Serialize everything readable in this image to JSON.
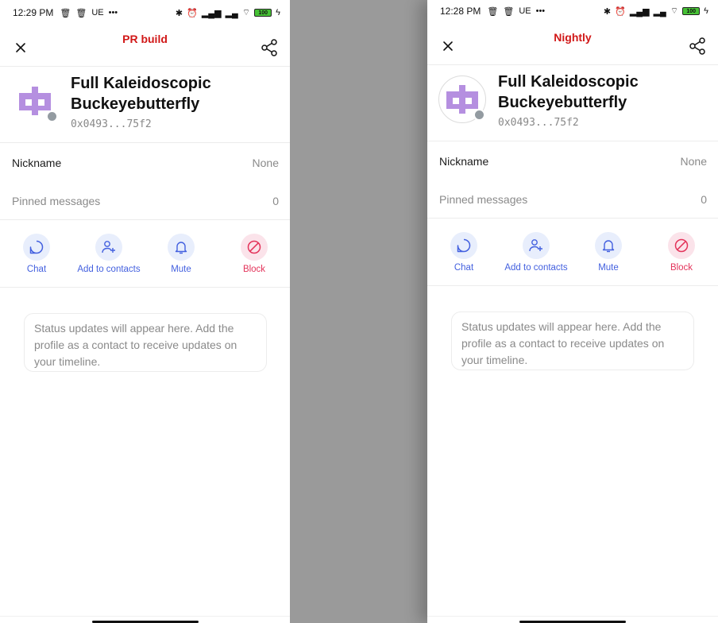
{
  "screens": [
    {
      "id": "left",
      "status_bar": {
        "time": "12:29 PM",
        "carrier": "UE",
        "battery": "100"
      },
      "build_label": "PR build",
      "profile": {
        "display_name": "Full Kaleidoscopic Buckeyebutterfly",
        "chat_key": "0x0493...75f2"
      },
      "rows": {
        "nickname_label": "Nickname",
        "nickname_value": "None",
        "pinned_label": "Pinned messages",
        "pinned_value": "0"
      },
      "actions": {
        "chat": "Chat",
        "add_contact": "Add to contacts",
        "mute": "Mute",
        "block": "Block"
      },
      "status_placeholder": "Status updates will appear here. Add the profile as a contact to receive updates on your timeline."
    },
    {
      "id": "right",
      "status_bar": {
        "time": "12:28 PM",
        "carrier": "UE",
        "battery": "100"
      },
      "build_label": "Nightly",
      "profile": {
        "display_name": "Full Kaleidoscopic Buckeyebutterfly",
        "chat_key": "0x0493...75f2"
      },
      "rows": {
        "nickname_label": "Nickname",
        "nickname_value": "None",
        "pinned_label": "Pinned messages",
        "pinned_value": "0"
      },
      "actions": {
        "chat": "Chat",
        "add_contact": "Add to contacts",
        "mute": "Mute",
        "block": "Block"
      },
      "status_placeholder": "Status updates will appear here. Add the profile as a contact to receive updates on your timeline."
    }
  ],
  "colors": {
    "build_label": "#d11818",
    "action_accent": "#4360df",
    "action_bg": "#e8eefc",
    "block_accent": "#e3335a",
    "block_bg": "#fbe3ea",
    "avatar": "#b58fe0",
    "divider_band": "#9a9a9a"
  },
  "icons": [
    "close-icon",
    "share-icon",
    "chat-icon",
    "add-user-icon",
    "bell-icon",
    "block-icon",
    "trash-icon",
    "bluetooth-icon",
    "wifi-icon",
    "signal-icon",
    "battery-icon"
  ]
}
